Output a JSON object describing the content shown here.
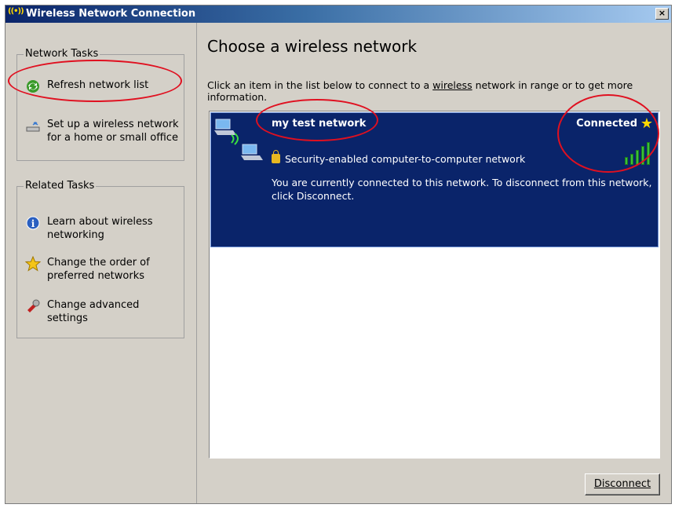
{
  "window": {
    "title": "Wireless Network Connection",
    "title_icon": "((•))",
    "close_label": "×"
  },
  "sidebar": {
    "network_tasks": {
      "title": "Network Tasks",
      "items": [
        {
          "label": "Refresh network list",
          "icon": "refresh-icon"
        },
        {
          "label": "Set up a wireless network for a home or small office",
          "icon": "wireless-setup-icon"
        }
      ]
    },
    "related_tasks": {
      "title": "Related Tasks",
      "items": [
        {
          "label": "Learn about wireless networking",
          "icon": "info-icon"
        },
        {
          "label": "Change the order of preferred networks",
          "icon": "star-icon"
        },
        {
          "label": "Change advanced settings",
          "icon": "settings-icon"
        }
      ]
    }
  },
  "main": {
    "heading": "Choose a wireless network",
    "description_before": "Click an item in the list below to connect to a ",
    "description_link": "wireless",
    "description_after": " network in range or to get more information.",
    "network": {
      "name": "my test network",
      "status": "Connected",
      "security": "Security-enabled computer-to-computer network",
      "message": "You are currently connected to this network. To disconnect from this network, click Disconnect.",
      "signal_bars": 5
    },
    "disconnect_button": "Disconnect"
  },
  "colors": {
    "selection": "#0a246a",
    "window_bg": "#d4d0c8",
    "annotation": "#e01020"
  }
}
